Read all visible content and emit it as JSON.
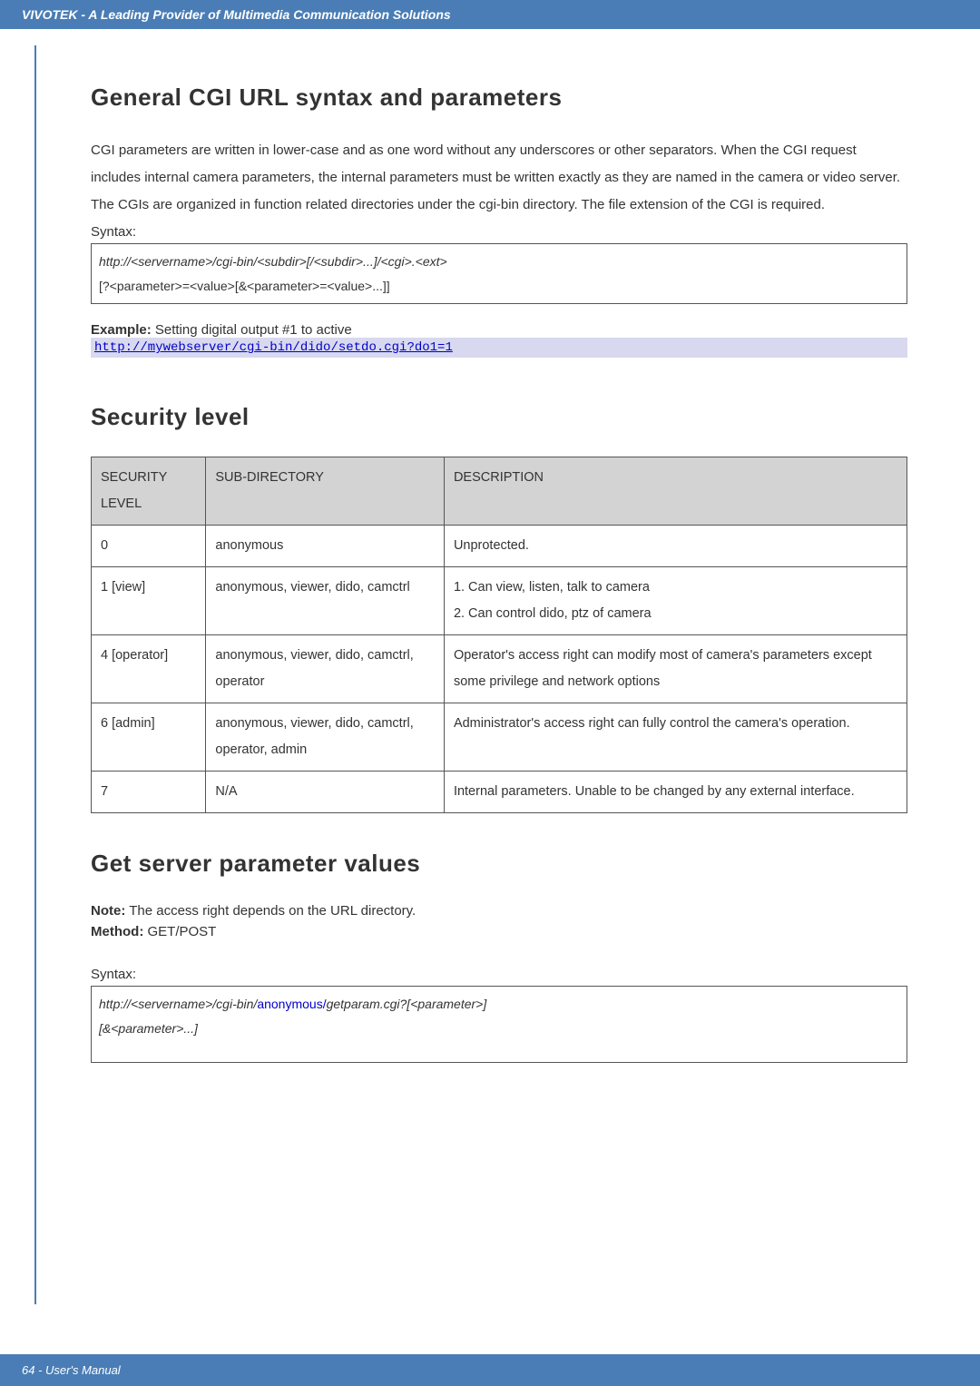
{
  "header": {
    "title": "VIVOTEK - A Leading Provider of Multimedia Communication Solutions"
  },
  "section1": {
    "heading": "General CGI URL syntax and parameters",
    "paragraph": "CGI parameters are written in lower-case and as one word without any underscores or other separators. When the CGI request includes internal camera parameters, the internal parameters must be written exactly as they are named in the camera or video server. The CGIs are organized in function related directories under the cgi-bin directory. The file extension of the CGI is required.",
    "syntax_label": "Syntax:",
    "syntax_line1_a": "http://<servername>/cgi-bin/<subdir>[/<subdir>...]/<cgi>.<ext>",
    "syntax_line2": "[?<parameter>=<value>[&<parameter>=<value>...]]",
    "example_label_bold": "Example:",
    "example_label_rest": " Setting digital output #1 to active",
    "example_url": "http://mywebserver/cgi-bin/dido/setdo.cgi?do1=1"
  },
  "section2": {
    "heading": "Security level",
    "headers": {
      "c1": "SECURITY LEVEL",
      "c2": "SUB-DIRECTORY",
      "c3": "DESCRIPTION"
    },
    "rows": [
      {
        "level": "0",
        "sub": "anonymous",
        "desc": "Unprotected."
      },
      {
        "level": "1 [view]",
        "sub": "anonymous, viewer, dido, camctrl",
        "desc": "1. Can view, listen, talk to camera\n2. Can control dido, ptz of camera"
      },
      {
        "level": "4 [operator]",
        "sub": "anonymous, viewer, dido, camctrl, operator",
        "desc": "Operator's access right can modify most of camera's parameters except some privilege and network options"
      },
      {
        "level": "6 [admin]",
        "sub": "anonymous, viewer, dido, camctrl, operator, admin",
        "desc": "Administrator's access right can fully control the camera's operation."
      },
      {
        "level": "7",
        "sub": "N/A",
        "desc": "Internal parameters. Unable to be changed by any external interface."
      }
    ]
  },
  "section3": {
    "heading": "Get server parameter values",
    "note_bold": "Note:",
    "note_rest": " The access right depends on the URL directory.",
    "method_bold": "Method:",
    "method_rest": " GET/POST",
    "syntax_label": "Syntax:",
    "box_pre": "http://<servername>/cgi-bin/",
    "box_anon": "anonymous/",
    "box_post": "getparam.cgi?[<parameter>]",
    "box_line2": "[&<parameter>...]"
  },
  "footer": {
    "text": "64 - User's Manual"
  }
}
